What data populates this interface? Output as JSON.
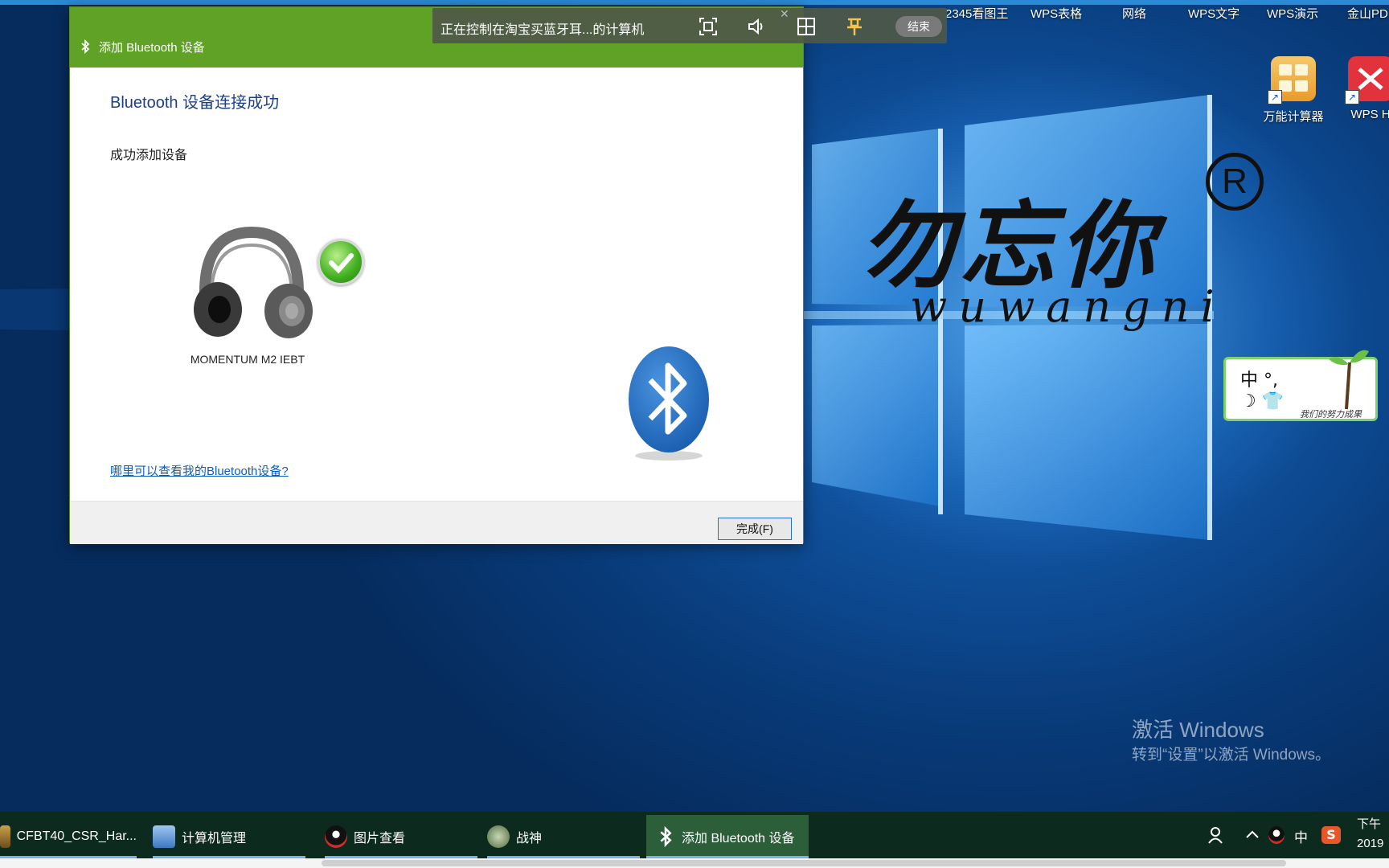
{
  "remote_toolbar": {
    "status_text": "正在控制在淘宝买蓝牙耳...的计算机",
    "end_label": "结束",
    "close_glyph": "✕"
  },
  "desktop": {
    "top_labels": [
      "2345看图王",
      "WPS表格",
      "网络",
      "WPS文字",
      "WPS演示",
      "金山PD"
    ],
    "icons": [
      {
        "label": "万能计算器",
        "icon": "calculator-icon"
      },
      {
        "label": "WPS H",
        "icon": "wps-icon"
      }
    ],
    "brand": {
      "cn": "勿忘你",
      "en": "wuwangni",
      "reg": "R"
    },
    "ime": {
      "top": "中 °,",
      "bottom": "☽ 👕",
      "slogan": "我们的努力成果"
    },
    "activation": {
      "title": "激活 Windows",
      "subtitle": "转到“设置”以激活 Windows。"
    }
  },
  "dialog": {
    "title": "添加 Bluetooth 设备",
    "heading": "Bluetooth 设备连接成功",
    "subheading": "成功添加设备",
    "device_name": "MOMENTUM M2 IEBT",
    "help_link": "哪里可以查看我的Bluetooth设备?",
    "finish_button": "完成(F)"
  },
  "taskbar": {
    "tasks": [
      {
        "label": "CFBT40_CSR_Har...",
        "icon": "app-icon"
      },
      {
        "label": "计算机管理",
        "icon": "computer-management-icon"
      },
      {
        "label": "图片查看",
        "icon": "qq-penguin-icon"
      },
      {
        "label": "战神",
        "icon": "game-icon"
      },
      {
        "label": "添加 Bluetooth 设备",
        "icon": "bluetooth-icon"
      }
    ],
    "tray": {
      "ime": "中",
      "clock_top": "下午",
      "clock_bottom": "2019"
    }
  },
  "colors": {
    "dialog_title_bar": "#5fa225",
    "taskbar": "#0c2a1e",
    "link": "#0b5ec0",
    "heading": "#1c3f8a"
  }
}
